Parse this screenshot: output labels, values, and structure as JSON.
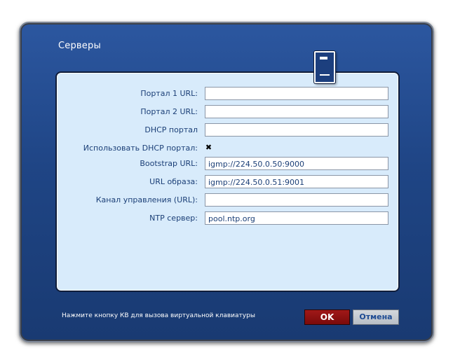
{
  "dialog": {
    "title": "Серверы",
    "hint": "Нажмите кнопку КВ для вызова виртуальной клавиатуры"
  },
  "icon": "server-icon",
  "fields": [
    {
      "label": "Портал 1 URL:",
      "value": ""
    },
    {
      "label": "Портал 2 URL:",
      "value": ""
    },
    {
      "label": "DHCP портал",
      "value": ""
    },
    {
      "label": "Использовать DHCP портал:",
      "checked_glyph": "✖"
    },
    {
      "label": "Bootstrap URL:",
      "value": "igmp://224.50.0.50:9000"
    },
    {
      "label": "URL образа:",
      "value": "igmp://224.50.0.51:9001"
    },
    {
      "label": "Канал управления (URL):",
      "value": ""
    },
    {
      "label": "NTP сервер:",
      "value": "pool.ntp.org"
    }
  ],
  "buttons": {
    "ok": "OK",
    "cancel": "Отмена"
  },
  "colors": {
    "dialog_bg": "#1f4585",
    "panel_bg": "#d8ebfb",
    "ok_bg": "#8b1010",
    "cancel_bg": "#c5cad0",
    "label_text": "#1b3f77"
  }
}
